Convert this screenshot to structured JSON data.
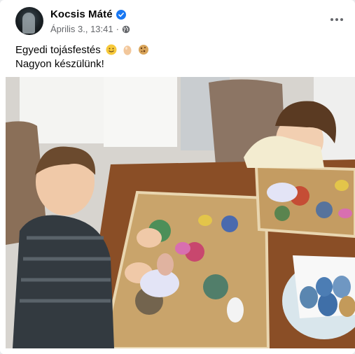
{
  "post": {
    "author": "Kocsis Máté",
    "timestamp": "Április 3., 13:41",
    "separator": "·",
    "text_line1": "Egyedi tojásfestés",
    "text_line2": "Nagyon készülünk!"
  },
  "icons": {
    "verified": "verified-badge-icon",
    "audience": "globe-icon",
    "more": "more-options-icon",
    "emoji1": "smiley-face-emoji",
    "emoji2": "egg-emoji",
    "emoji3": "cookie-emoji"
  },
  "colors": {
    "verified_blue": "#1877f2",
    "secondary_text": "#65676b",
    "primary_text": "#050505"
  }
}
